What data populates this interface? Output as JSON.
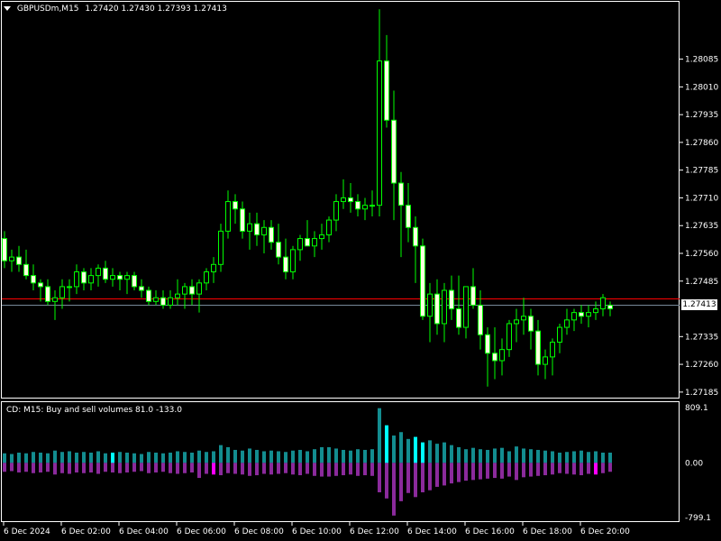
{
  "chart_header": {
    "symbol": "GBPUSDm,M15",
    "ohlc": "1.27420 1.27430 1.27393 1.27413",
    "dropdown_icon": "triangle-down-icon"
  },
  "indicator_header": {
    "text": "CD: M15: Buy and sell volumes  81.0 -133.0"
  },
  "last_price_tag": "1.27413",
  "colors": {
    "background": "#000000",
    "frame": "#ffffff",
    "bull_body": "#000000",
    "bear_body": "#ffffe0",
    "wick": "#00ff00",
    "price_line": "#778899",
    "red_line": "#ff0000",
    "buy_bar": "#138d90",
    "buy_bar_hi": "#00ffff",
    "sell_bar": "#8b2a9c",
    "sell_bar_hi": "#ff00ff"
  },
  "chart_data": [
    {
      "type": "candlestick",
      "price_axis_ticks": [
        "1.28085",
        "1.28010",
        "1.27935",
        "1.27860",
        "1.27785",
        "1.27710",
        "1.27635",
        "1.27560",
        "1.27485",
        "1.27335",
        "1.27260",
        "1.27185"
      ],
      "ylim": [
        1.2717,
        1.2824
      ],
      "time_labels": [
        "6 Dec 2024",
        "6 Dec 02:00",
        "6 Dec 04:00",
        "6 Dec 06:00",
        "6 Dec 08:00",
        "6 Dec 10:00",
        "6 Dec 12:00",
        "6 Dec 14:00",
        "6 Dec 16:00",
        "6 Dec 18:00",
        "6 Dec 20:00"
      ],
      "last_price": 1.27413,
      "red_line_price": 1.27435,
      "candles": [
        [
          1.276,
          1.2762,
          1.2752,
          1.2754
        ],
        [
          1.2754,
          1.2757,
          1.2751,
          1.2755
        ],
        [
          1.2755,
          1.2758,
          1.2751,
          1.2753
        ],
        [
          1.2753,
          1.2757,
          1.2749,
          1.275
        ],
        [
          1.275,
          1.2753,
          1.2746,
          1.2748
        ],
        [
          1.2748,
          1.2749,
          1.2743,
          1.2747
        ],
        [
          1.2747,
          1.2749,
          1.2742,
          1.2743
        ],
        [
          1.2743,
          1.2746,
          1.2738,
          1.2744
        ],
        [
          1.2744,
          1.2749,
          1.2741,
          1.2747
        ],
        [
          1.2747,
          1.2749,
          1.2743,
          1.2747
        ],
        [
          1.2747,
          1.2753,
          1.2745,
          1.2751
        ],
        [
          1.2751,
          1.2752,
          1.2746,
          1.2748
        ],
        [
          1.2748,
          1.2752,
          1.2746,
          1.275
        ],
        [
          1.275,
          1.2753,
          1.2747,
          1.2752
        ],
        [
          1.2752,
          1.2754,
          1.2748,
          1.2749
        ],
        [
          1.2749,
          1.2752,
          1.2747,
          1.275
        ],
        [
          1.275,
          1.2751,
          1.2746,
          1.2749
        ],
        [
          1.2749,
          1.2751,
          1.2745,
          1.275
        ],
        [
          1.275,
          1.2751,
          1.2746,
          1.2747
        ],
        [
          1.2747,
          1.2749,
          1.2744,
          1.2746
        ],
        [
          1.2746,
          1.2747,
          1.2742,
          1.2743
        ],
        [
          1.2743,
          1.2746,
          1.2742,
          1.2744
        ],
        [
          1.2744,
          1.2746,
          1.2741,
          1.2742
        ],
        [
          1.2742,
          1.2746,
          1.2741,
          1.2744
        ],
        [
          1.2744,
          1.2749,
          1.2742,
          1.2745
        ],
        [
          1.2745,
          1.2748,
          1.2741,
          1.2747
        ],
        [
          1.2747,
          1.2749,
          1.2742,
          1.2745
        ],
        [
          1.2745,
          1.2749,
          1.274,
          1.2748
        ],
        [
          1.2748,
          1.2752,
          1.2746,
          1.2751
        ],
        [
          1.2751,
          1.2755,
          1.2748,
          1.2753
        ],
        [
          1.2753,
          1.2764,
          1.2751,
          1.2762
        ],
        [
          1.2762,
          1.2773,
          1.276,
          1.277
        ],
        [
          1.277,
          1.2772,
          1.2764,
          1.2768
        ],
        [
          1.2768,
          1.277,
          1.276,
          1.2762
        ],
        [
          1.2762,
          1.2767,
          1.2757,
          1.2764
        ],
        [
          1.2764,
          1.2767,
          1.2758,
          1.2761
        ],
        [
          1.2761,
          1.2765,
          1.2756,
          1.2763
        ],
        [
          1.2763,
          1.2765,
          1.2757,
          1.2759
        ],
        [
          1.2759,
          1.2764,
          1.2753,
          1.2755
        ],
        [
          1.2755,
          1.276,
          1.2749,
          1.2751
        ],
        [
          1.2751,
          1.2758,
          1.2749,
          1.2757
        ],
        [
          1.2757,
          1.2761,
          1.2754,
          1.276
        ],
        [
          1.276,
          1.2765,
          1.2758,
          1.2758
        ],
        [
          1.2758,
          1.2762,
          1.2755,
          1.276
        ],
        [
          1.276,
          1.2764,
          1.2757,
          1.2761
        ],
        [
          1.2761,
          1.2766,
          1.2759,
          1.2765
        ],
        [
          1.2765,
          1.2772,
          1.2762,
          1.277
        ],
        [
          1.277,
          1.2776,
          1.2768,
          1.2771
        ],
        [
          1.2771,
          1.2775,
          1.2767,
          1.277
        ],
        [
          1.277,
          1.2772,
          1.2766,
          1.2768
        ],
        [
          1.2768,
          1.2771,
          1.2765,
          1.2769
        ],
        [
          1.2769,
          1.2773,
          1.2766,
          1.2769
        ],
        [
          1.2769,
          1.2822,
          1.2766,
          1.2808
        ],
        [
          1.2808,
          1.2815,
          1.279,
          1.2792
        ],
        [
          1.2792,
          1.28,
          1.2765,
          1.2775
        ],
        [
          1.2775,
          1.2778,
          1.2755,
          1.2769
        ],
        [
          1.2769,
          1.2775,
          1.2759,
          1.2763
        ],
        [
          1.2763,
          1.2766,
          1.2748,
          1.2758
        ],
        [
          1.2758,
          1.276,
          1.2738,
          1.2739
        ],
        [
          1.2739,
          1.2748,
          1.2732,
          1.2745
        ],
        [
          1.2745,
          1.2749,
          1.2734,
          1.2737
        ],
        [
          1.2737,
          1.2748,
          1.2732,
          1.2746
        ],
        [
          1.2746,
          1.275,
          1.2738,
          1.2741
        ],
        [
          1.2741,
          1.275,
          1.2734,
          1.2736
        ],
        [
          1.2736,
          1.2747,
          1.2733,
          1.2747
        ],
        [
          1.2747,
          1.2752,
          1.2741,
          1.2742
        ],
        [
          1.2742,
          1.2746,
          1.273,
          1.2734
        ],
        [
          1.2734,
          1.2736,
          1.272,
          1.2729
        ],
        [
          1.2729,
          1.2736,
          1.2722,
          1.2727
        ],
        [
          1.2727,
          1.2733,
          1.2723,
          1.273
        ],
        [
          1.273,
          1.2738,
          1.2728,
          1.2737
        ],
        [
          1.2737,
          1.2741,
          1.2732,
          1.2738
        ],
        [
          1.2738,
          1.2744,
          1.2734,
          1.2739
        ],
        [
          1.2739,
          1.2741,
          1.273,
          1.2735
        ],
        [
          1.2735,
          1.2738,
          1.2723,
          1.2726
        ],
        [
          1.2726,
          1.273,
          1.2722,
          1.2728
        ],
        [
          1.2728,
          1.2733,
          1.2723,
          1.2732
        ],
        [
          1.2732,
          1.2737,
          1.2729,
          1.2736
        ],
        [
          1.2736,
          1.2741,
          1.2734,
          1.2738
        ],
        [
          1.2738,
          1.2741,
          1.2735,
          1.274
        ],
        [
          1.274,
          1.2742,
          1.2737,
          1.2739
        ],
        [
          1.2739,
          1.2742,
          1.2736,
          1.274
        ],
        [
          1.274,
          1.2743,
          1.2738,
          1.2741
        ],
        [
          1.2741,
          1.2745,
          1.2739,
          1.2744
        ],
        [
          1.2742,
          1.2743,
          1.2739,
          1.2741
        ]
      ]
    },
    {
      "type": "bar",
      "axis_ticks": [
        "809.1",
        "0.00",
        "-799.1"
      ],
      "ylim": [
        -799.1,
        809.1
      ],
      "buy": [
        140,
        130,
        150,
        140,
        160,
        150,
        140,
        180,
        160,
        170,
        150,
        160,
        150,
        170,
        140,
        150,
        160,
        150,
        140,
        130,
        160,
        150,
        140,
        150,
        170,
        160,
        150,
        180,
        160,
        170,
        260,
        230,
        190,
        180,
        210,
        190,
        170,
        180,
        170,
        160,
        180,
        190,
        170,
        200,
        230,
        230,
        210,
        190,
        180,
        200,
        190,
        200,
        800,
        550,
        400,
        450,
        350,
        380,
        300,
        330,
        280,
        300,
        260,
        230,
        200,
        220,
        200,
        190,
        210,
        220,
        170,
        240,
        210,
        200,
        190,
        180,
        170,
        150,
        160,
        170,
        180,
        160,
        170,
        150,
        150
      ],
      "sell": [
        -130,
        -120,
        -140,
        -130,
        -150,
        -140,
        -130,
        -170,
        -150,
        -160,
        -140,
        -150,
        -140,
        -160,
        -130,
        -140,
        -150,
        -140,
        -130,
        -120,
        -150,
        -140,
        -130,
        -150,
        -160,
        -150,
        -140,
        -220,
        -160,
        -170,
        -180,
        -150,
        -160,
        -170,
        -190,
        -180,
        -160,
        -170,
        -160,
        -150,
        -170,
        -180,
        -160,
        -190,
        -200,
        -200,
        -190,
        -180,
        -170,
        -190,
        -180,
        -190,
        -430,
        -520,
        -770,
        -560,
        -440,
        -500,
        -430,
        -400,
        -350,
        -330,
        -300,
        -280,
        -260,
        -250,
        -240,
        -230,
        -220,
        -230,
        -200,
        -250,
        -210,
        -200,
        -190,
        -180,
        -170,
        -150,
        -160,
        -170,
        -180,
        -160,
        -170,
        -150,
        -130
      ],
      "buy_highlight_indices": [
        15,
        53,
        57,
        58,
        85
      ],
      "sell_highlight_indices": [
        29,
        82
      ]
    }
  ]
}
